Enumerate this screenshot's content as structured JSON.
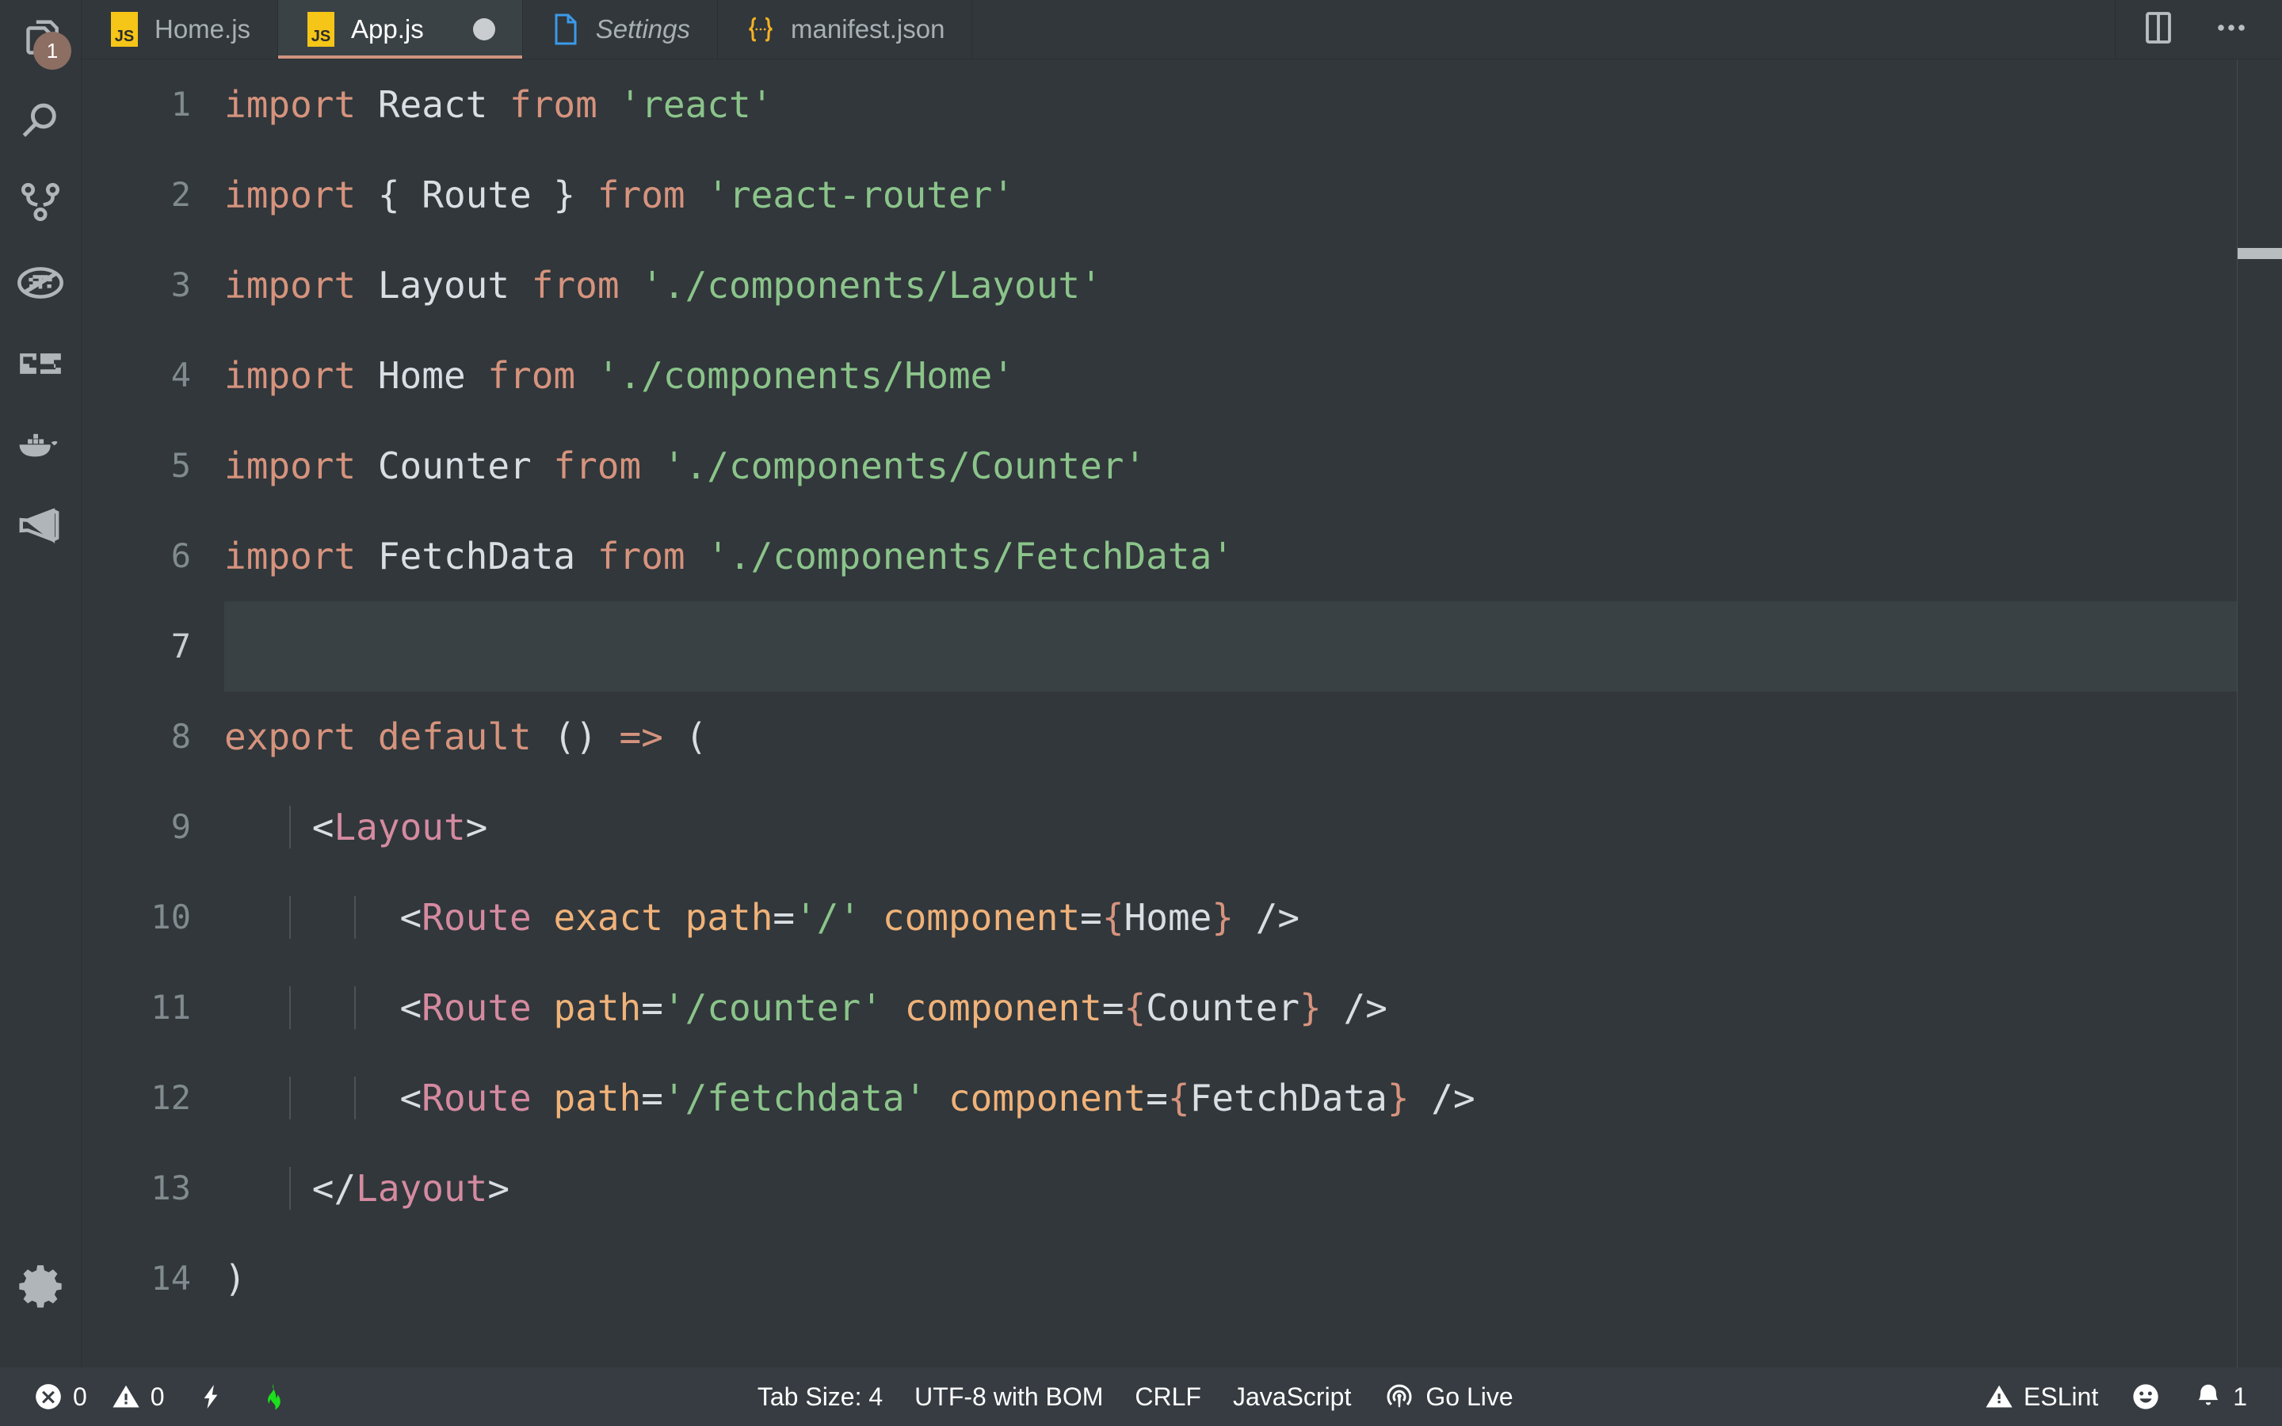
{
  "theme": {
    "bg": "#31373B",
    "tab_active_bg": "#3B4246",
    "tab_active_underline": "#D09480",
    "statusbar_bg": "#363C41",
    "badge_bg": "#8D6E63",
    "keyword": "#D6937D",
    "string": "#8BC48A",
    "identifier": "#D8DEE3",
    "jsx_tag": "#D58AA0",
    "jsx_attr": "#F0B279",
    "line_number": "#808A8F",
    "current_line_bg": "#3A4145"
  },
  "activitybar": {
    "items": [
      {
        "name": "explorer",
        "icon": "files-icon",
        "badge": "1"
      },
      {
        "name": "search",
        "icon": "search-icon",
        "badge": ""
      },
      {
        "name": "source-control",
        "icon": "source-control-icon",
        "badge": ""
      },
      {
        "name": "run-and-debug",
        "icon": "debug-disabled-icon",
        "badge": ""
      },
      {
        "name": "extensions",
        "icon": "extensions-icon",
        "badge": ""
      },
      {
        "name": "docker",
        "icon": "docker-icon",
        "badge": ""
      },
      {
        "name": "vscode",
        "icon": "vscode-icon",
        "badge": ""
      }
    ],
    "bottom": [
      {
        "name": "manage",
        "icon": "gear-icon"
      }
    ]
  },
  "tabs": [
    {
      "label": "Home.js",
      "icon": "js-file-icon",
      "active": false,
      "dirty": false,
      "italic": false
    },
    {
      "label": "App.js",
      "icon": "js-file-icon",
      "active": true,
      "dirty": true,
      "italic": false
    },
    {
      "label": "Settings",
      "icon": "generic-file-icon",
      "active": false,
      "dirty": false,
      "italic": true
    },
    {
      "label": "manifest.json",
      "icon": "json-file-icon",
      "active": false,
      "dirty": false,
      "italic": false
    }
  ],
  "tab_actions": [
    {
      "name": "split-editor-button",
      "icon": "split-editor-icon"
    },
    {
      "name": "more-actions-button",
      "icon": "ellipsis-icon"
    }
  ],
  "editor": {
    "language": "JavaScript",
    "current_line": 7,
    "lines": [
      {
        "n": "1",
        "text": "import React from 'react'"
      },
      {
        "n": "2",
        "text": "import { Route } from 'react-router'"
      },
      {
        "n": "3",
        "text": "import Layout from './components/Layout'"
      },
      {
        "n": "4",
        "text": "import Home from './components/Home'"
      },
      {
        "n": "5",
        "text": "import Counter from './components/Counter'"
      },
      {
        "n": "6",
        "text": "import FetchData from './components/FetchData'"
      },
      {
        "n": "7",
        "text": ""
      },
      {
        "n": "8",
        "text": "export default () => ("
      },
      {
        "n": "9",
        "text": "    <Layout>"
      },
      {
        "n": "10",
        "text": "        <Route exact path='/' component={Home} />"
      },
      {
        "n": "11",
        "text": "        <Route path='/counter' component={Counter} />"
      },
      {
        "n": "12",
        "text": "        <Route path='/fetchdata' component={FetchData} />"
      },
      {
        "n": "13",
        "text": "    </Layout>"
      },
      {
        "n": "14",
        "text": ")"
      }
    ]
  },
  "statusbar": {
    "errors": "0",
    "warnings": "0",
    "tab_size": "Tab Size: 4",
    "encoding": "UTF-8 with BOM",
    "eol": "CRLF",
    "language": "JavaScript",
    "go_live": "Go Live",
    "eslint": "ESLint",
    "notifications": "1"
  }
}
